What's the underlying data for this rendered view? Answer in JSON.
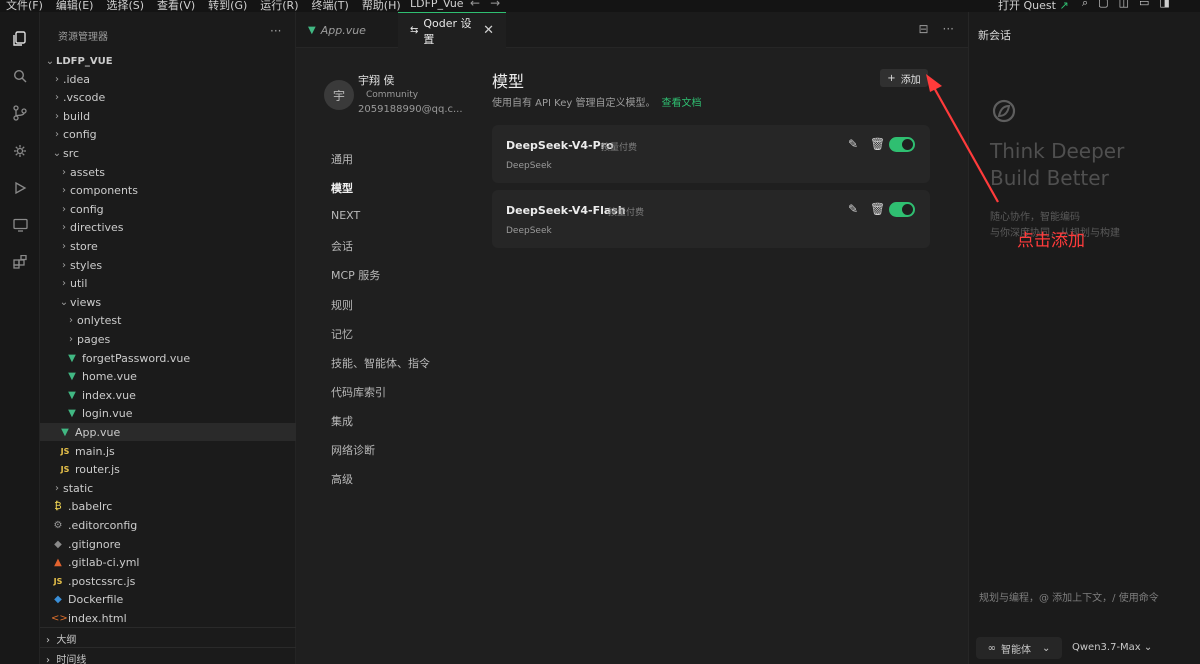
{
  "menubar": {
    "menus": [
      "文件(F)",
      "编辑(E)",
      "选择(S)",
      "查看(V)",
      "转到(G)",
      "运行(R)",
      "终端(T)",
      "帮助(H)"
    ],
    "window_title": "LDFP_Vue",
    "quest_label": "打开 Quest"
  },
  "explorer": {
    "title": "资源管理器",
    "root": "LDFP_VUE",
    "items": [
      {
        "label": ".idea",
        "chev": "›",
        "icon": ""
      },
      {
        "label": ".vscode",
        "chev": "›",
        "icon": ""
      },
      {
        "label": "build",
        "chev": "›",
        "icon": ""
      },
      {
        "label": "config",
        "chev": "›",
        "icon": ""
      },
      {
        "label": "src",
        "chev": "⌄",
        "icon": ""
      },
      {
        "label": "assets",
        "chev": "›",
        "icon": ""
      },
      {
        "label": "components",
        "chev": "›",
        "icon": ""
      },
      {
        "label": "config",
        "chev": "›",
        "icon": ""
      },
      {
        "label": "directives",
        "chev": "›",
        "icon": ""
      },
      {
        "label": "store",
        "chev": "›",
        "icon": ""
      },
      {
        "label": "styles",
        "chev": "›",
        "icon": ""
      },
      {
        "label": "util",
        "chev": "›",
        "icon": ""
      },
      {
        "label": "views",
        "chev": "⌄",
        "icon": ""
      },
      {
        "label": "onlytest",
        "chev": "›",
        "icon": ""
      },
      {
        "label": "pages",
        "chev": "›",
        "icon": ""
      },
      {
        "label": "forgetPassword.vue",
        "chev": "",
        "icon": "vue"
      },
      {
        "label": "home.vue",
        "chev": "",
        "icon": "vue"
      },
      {
        "label": "index.vue",
        "chev": "",
        "icon": "vue"
      },
      {
        "label": "login.vue",
        "chev": "",
        "icon": "vue"
      },
      {
        "label": "App.vue",
        "chev": "",
        "icon": "vue"
      },
      {
        "label": "main.js",
        "chev": "",
        "icon": "js"
      },
      {
        "label": "router.js",
        "chev": "",
        "icon": "js"
      },
      {
        "label": "static",
        "chev": "›",
        "icon": ""
      },
      {
        "label": ".babelrc",
        "chev": "",
        "icon": "babel"
      },
      {
        "label": ".editorconfig",
        "chev": "",
        "icon": "cfg"
      },
      {
        "label": ".gitignore",
        "chev": "",
        "icon": "git"
      },
      {
        "label": ".gitlab-ci.yml",
        "chev": "",
        "icon": "gitlab"
      },
      {
        "label": ".postcssrc.js",
        "chev": "",
        "icon": "js"
      },
      {
        "label": "Dockerfile",
        "chev": "",
        "icon": "docker"
      },
      {
        "label": "index.html",
        "chev": "",
        "icon": "html"
      }
    ],
    "outline": "大纲",
    "timeline": "时间线"
  },
  "tabs": [
    {
      "label": "App.vue"
    },
    {
      "label": "Qoder 设置"
    }
  ],
  "settings": {
    "user": {
      "avatar_char": "宇",
      "name": "宇翔 侯",
      "plan": "Community",
      "email": "2059188990@qq.c..."
    },
    "nav": [
      "通用",
      "模型",
      "NEXT",
      "会话",
      "MCP 服务",
      "规则",
      "记忆",
      "技能、智能体、指令",
      "代码库索引",
      "集成",
      "网络诊断",
      "高级"
    ],
    "active_nav": "模型",
    "section_title": "模型",
    "section_desc": "使用自有 API Key 管理自定义模型。",
    "docs_link": "查看文档",
    "add_button": "添加",
    "models": [
      {
        "name": "DeepSeek-V4-Pro",
        "billing": "按量付费",
        "provider": "DeepSeek",
        "enabled": true
      },
      {
        "name": "DeepSeek-V4-Flash",
        "billing": "按量付费",
        "provider": "DeepSeek",
        "enabled": true
      }
    ]
  },
  "annotation": {
    "text": "点击添加",
    "color": "#ff3b3b"
  },
  "chat": {
    "title": "新会话",
    "slogan_line1": "Think Deeper",
    "slogan_line2": "Build Better",
    "sub_line1": "随心协作，智能编码",
    "sub_line2": "与你深度协同，从规划与构建",
    "input_placeholder": "规划与编程，@ 添加上下文，/ 使用命令",
    "agent_mode": "智能体",
    "model": "Qwen3.7-Max"
  },
  "colors": {
    "accent": "#2fbf71",
    "background": "#1b1b1b",
    "panel": "#1f1f1f",
    "card": "#262626"
  }
}
